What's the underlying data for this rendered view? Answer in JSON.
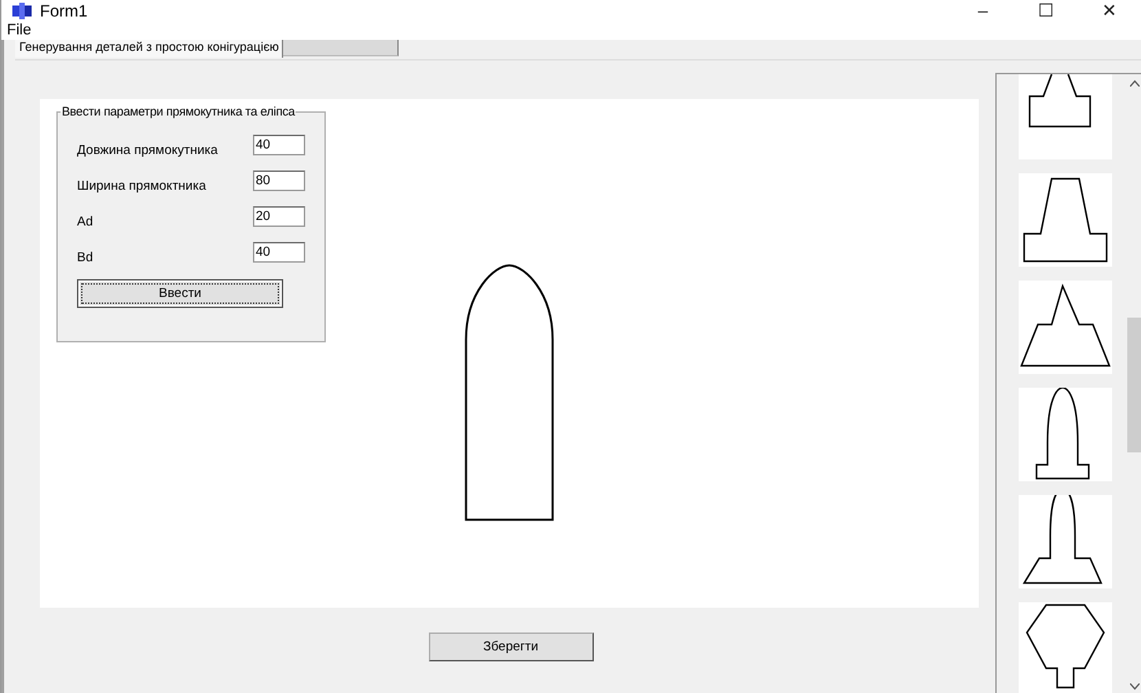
{
  "window": {
    "title": "Form1",
    "controls": [
      "–",
      "☐",
      "✕"
    ]
  },
  "menu": [
    "File"
  ],
  "tabs": [
    {
      "label": "Генерування деталей з простою конігурацією",
      "selected": true
    },
    {
      "selected": false
    }
  ],
  "params_group": {
    "title": "Ввести параметри прямокутника та еліпса",
    "fields": [
      {
        "label": "Довжина прямокутника",
        "value": "40"
      },
      {
        "label": "Ширина прямоктника",
        "value": "80"
      },
      {
        "label": "Ad",
        "value": "20"
      },
      {
        "label": "Bd",
        "value": "40"
      }
    ],
    "button": "Ввести"
  },
  "thumbnails": [
    {
      "kind": "trapezoid_step_cut"
    },
    {
      "kind": "trapezoid_step"
    },
    {
      "kind": "triangle_step"
    },
    {
      "kind": "arch_step"
    },
    {
      "kind": "arch_trapezoid"
    },
    {
      "kind": "hexagon_stem"
    }
  ],
  "save_button": "Зберегти"
}
